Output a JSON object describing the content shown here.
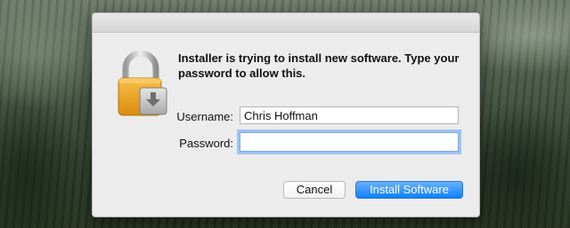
{
  "dialog": {
    "message": "Installer is trying to install new software. Type your password to allow this.",
    "username_label": "Username:",
    "username_value": "Chris Hoffman",
    "password_label": "Password:",
    "password_value": "",
    "cancel_label": "Cancel",
    "install_label": "Install Software",
    "icon": "padlock-with-installer-icon"
  },
  "colors": {
    "accent": "#1a85ff",
    "lock_gold": "#f0a828",
    "focus_ring": "#9dc2f2"
  }
}
